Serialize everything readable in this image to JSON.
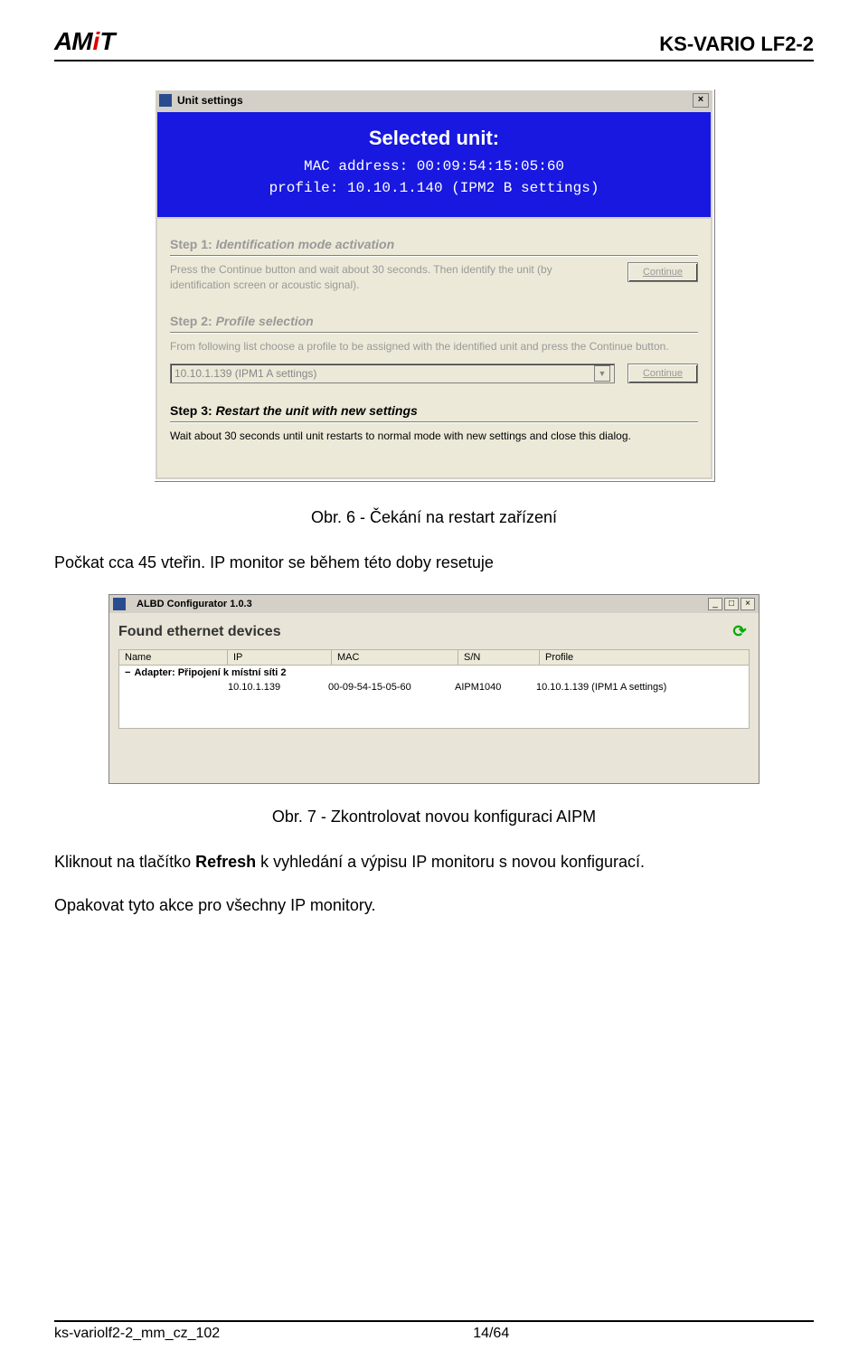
{
  "header": {
    "doc_title": "KS-VARIO LF2-2"
  },
  "win1": {
    "title": "Unit settings",
    "selected_label": "Selected unit:",
    "mac_line": "MAC address: 00:09:54:15:05:60",
    "profile_line": "profile: 10.10.1.140  (IPM2 B settings)",
    "step1_title": "Step 1:",
    "step1_label": "Identification mode activation",
    "step1_text": "Press the Continue button and wait about 30 seconds. Then identify the unit (by identification screen or acoustic signal).",
    "step2_title": "Step 2:",
    "step2_label": "Profile selection",
    "step2_text": "From following list choose a profile to be assigned with the identified unit and press the Continue button.",
    "step2_combo": "10.10.1.139 (IPM1 A settings)",
    "step3_title": "Step 3:",
    "step3_label": "Restart the unit with new settings",
    "step3_text": "Wait about 30 seconds until unit restarts to normal mode with new settings and close this dialog.",
    "btn_continue": "Continue"
  },
  "caption1": "Obr. 6 - Čekání na restart zařízení",
  "body1": "Počkat cca 45 vteřin. IP monitor se během této doby resetuje",
  "win2": {
    "title": "ALBD Configurator 1.0.3",
    "found": "Found ethernet devices",
    "head": {
      "name": "Name",
      "ip": "IP",
      "mac": "MAC",
      "sn": "S/N",
      "profile": "Profile"
    },
    "adapter": "Adapter: Připojení k místní síti 2",
    "row": {
      "ip": "10.10.1.139",
      "mac": "00-09-54-15-05-60",
      "sn": "AIPM1040",
      "profile": "10.10.1.139 (IPM1 A settings)"
    }
  },
  "caption2": "Obr. 7 - Zkontrolovat novou konfiguraci AIPM",
  "body2a": "Kliknout na tlačítko ",
  "body2_bold": "Refresh",
  "body2b": " k vyhledání a výpisu IP monitoru s novou konfigurací.",
  "body3": "Opakovat tyto akce pro všechny IP monitory.",
  "footer": {
    "file": "ks-variolf2-2_mm_cz_102",
    "page": "14/64"
  }
}
